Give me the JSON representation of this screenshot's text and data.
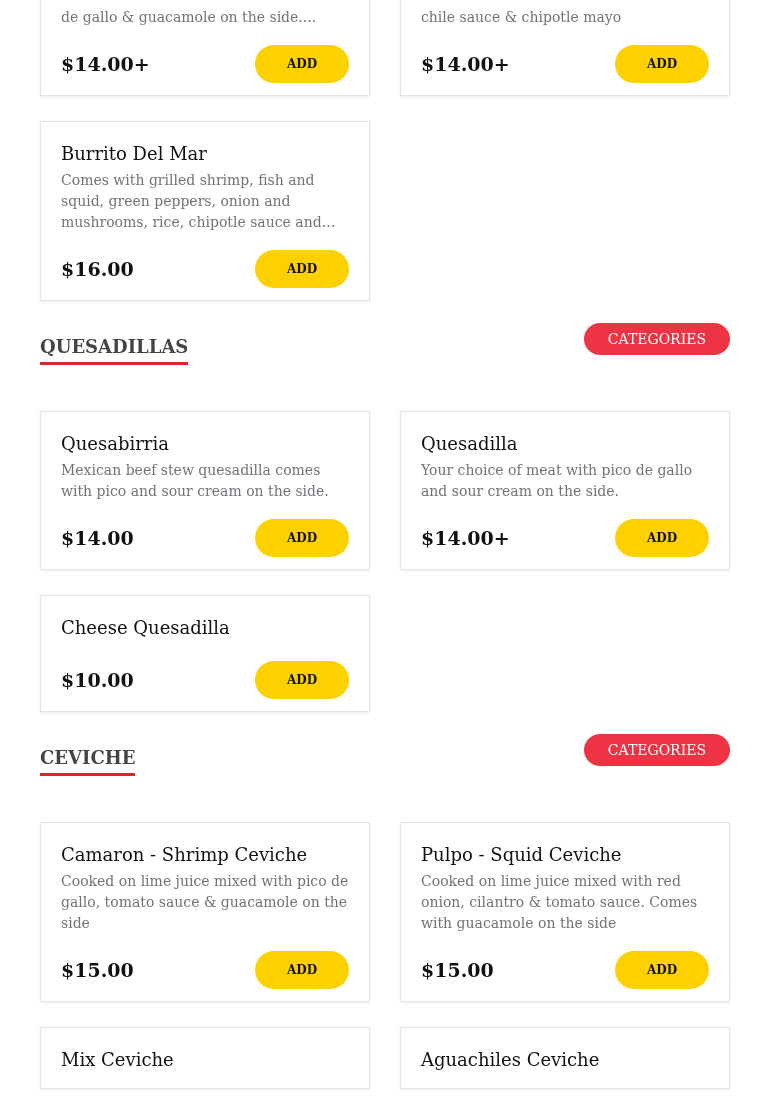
{
  "sections": [
    {
      "items": [
        {
          "description": "de gallo & guacamole on the side....",
          "price": "$14.00+",
          "button": "ADD"
        },
        {
          "description": "chile sauce & chipotle mayo",
          "price": "$14.00+",
          "button": "ADD"
        },
        {
          "name": "Burrito Del Mar",
          "description": "Comes with grilled shrimp, fish and squid, green peppers, onion and mushrooms, rice, chipotle sauce and…",
          "price": "$16.00",
          "button": "ADD"
        }
      ]
    },
    {
      "title": "QUESADILLAS",
      "categories_button": "CATEGORIES",
      "items": [
        {
          "name": "Quesabirria",
          "description": "Mexican beef stew quesadilla comes with pico and sour cream on the side.",
          "price": "$14.00",
          "button": "ADD"
        },
        {
          "name": "Quesadilla",
          "description": "Your choice of meat with pico de gallo and sour cream on the side.",
          "price": "$14.00+",
          "button": "ADD"
        },
        {
          "name": "Cheese Quesadilla",
          "price": "$10.00",
          "button": "ADD"
        }
      ]
    },
    {
      "title": "CEVICHE",
      "categories_button": "CATEGORIES",
      "items": [
        {
          "name": "Camaron - Shrimp Ceviche",
          "description": "Cooked on lime juice mixed with pico de gallo, tomato sauce & guacamole on the side",
          "price": "$15.00",
          "button": "ADD"
        },
        {
          "name": "Pulpo - Squid Ceviche",
          "description": "Cooked on lime juice mixed with red onion, cilantro & tomato sauce. Comes with guacamole on the side",
          "price": "$15.00",
          "button": "ADD"
        },
        {
          "name": "Mix Ceviche"
        },
        {
          "name": "Aguachiles Ceviche"
        }
      ]
    }
  ]
}
